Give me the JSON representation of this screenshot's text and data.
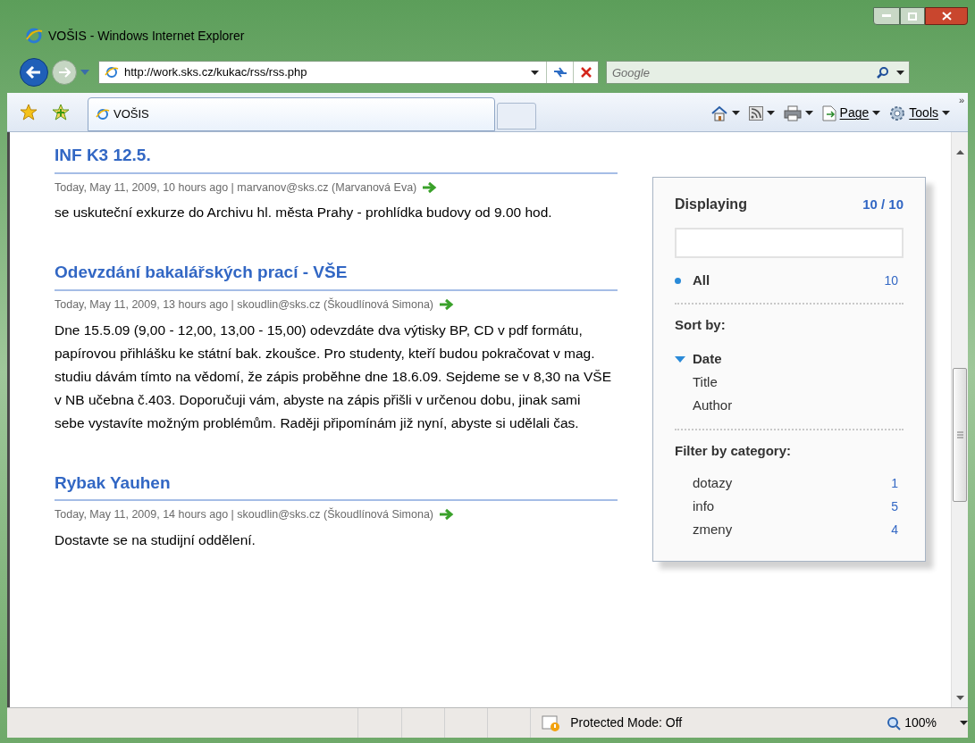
{
  "window": {
    "title": "VOŠIS - Windows Internet Explorer"
  },
  "address_bar": {
    "url": "http://work.sks.cz/kukac/rss/rss.php"
  },
  "search": {
    "placeholder": "Google"
  },
  "tabs": [
    {
      "label": "VOŠIS",
      "selected": true
    }
  ],
  "command_bar": [
    {
      "kind": "home"
    },
    {
      "kind": "feeds"
    },
    {
      "kind": "print"
    },
    {
      "kind": "page",
      "label": "Page"
    },
    {
      "kind": "tools",
      "label": "Tools"
    }
  ],
  "overflow": "»",
  "posts": [
    {
      "title": "INF K3 12.5.",
      "meta": "Today, May 11, 2009, 10 hours ago | marvanov@sks.cz (Marvanová Eva)",
      "body": "se uskuteční exkurze do Archivu hl. města Prahy - prohlídka budovy od 9.00 hod."
    },
    {
      "title": "Odevzdání bakalářských prací - VŠE",
      "meta": "Today, May 11, 2009, 13 hours ago | skoudlin@sks.cz (Škoudlínová Simona)",
      "body": "Dne 15.5.09 (9,00 - 12,00, 13,00 - 15,00) odevzdáte dva výtisky BP, CD v pdf formátu, papírovou přihlášku ke státní bak. zkoušce. Pro studenty, kteří budou pokračovat v mag. studiu dávám tímto na vědomí, že zápis proběhne dne 18.6.09. Sejdeme se v 8,30 na VŠE v NB učebna č.403. Doporučuji vám, abyste na zápis přišli v určenou dobu, jinak sami sebe vystavíte možným problémům. Raději připomínám již nyní, abyste si udělali čas."
    },
    {
      "title": "Rybak Yauhen",
      "meta": "Today, May 11, 2009, 14 hours ago | skoudlin@sks.cz (Škoudlínová Simona)",
      "body": "Dostavte se na studijní oddělení."
    }
  ],
  "sidebar": {
    "heading": "Displaying",
    "count": "10 / 10",
    "filter_all": {
      "label": "All",
      "count": "10",
      "selected": true
    },
    "sort_heading": "Sort by:",
    "sort_items": [
      {
        "label": "Date",
        "selected": true
      },
      {
        "label": "Title",
        "selected": false
      },
      {
        "label": "Author",
        "selected": false
      }
    ],
    "category_heading": "Filter by category:",
    "categories": [
      {
        "label": "dotazy",
        "count": "1",
        "selected": false
      },
      {
        "label": "info",
        "count": "5",
        "selected": false
      },
      {
        "label": "zmeny",
        "count": "4",
        "selected": false
      }
    ]
  },
  "status_bar": {
    "protected_mode": "Protected Mode: Off",
    "zoom": "100%"
  }
}
